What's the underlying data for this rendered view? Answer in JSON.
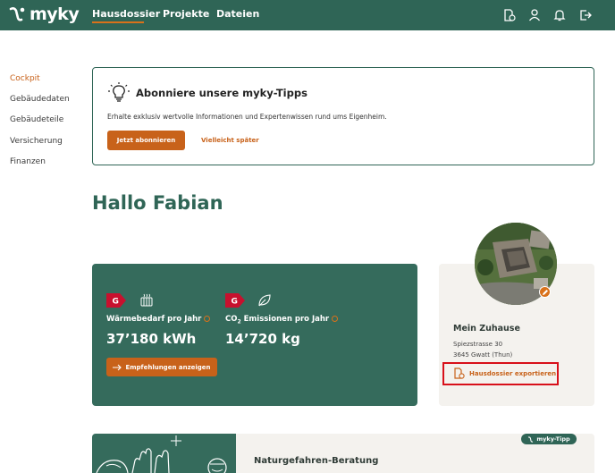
{
  "brand": {
    "name": "myky"
  },
  "nav": {
    "items": [
      {
        "label": "Hausdossier",
        "active": true
      },
      {
        "label": "Projekte"
      },
      {
        "label": "Dateien"
      }
    ],
    "icons": [
      "house-document-icon",
      "user-icon",
      "bell-icon",
      "logout-icon"
    ]
  },
  "sidebar": {
    "items": [
      {
        "label": "Cockpit",
        "active": true
      },
      {
        "label": "Gebäudedaten"
      },
      {
        "label": "Gebäudeteile"
      },
      {
        "label": "Versicherung"
      },
      {
        "label": "Finanzen"
      }
    ]
  },
  "tips": {
    "title": "Abonniere unsere myky-Tipps",
    "text": "Erhalte exklusiv wertvolle Informationen und Expertenwissen rund ums Eigenheim.",
    "subscribe_label": "Jetzt abonnieren",
    "later_label": "Vielleicht später"
  },
  "greeting": "Hallo Fabian",
  "energy": {
    "heat": {
      "grade": "G",
      "label": "Wärmebedarf pro Jahr",
      "value": "37’180 kWh"
    },
    "co2": {
      "grade": "G",
      "label_prefix": "CO",
      "label_sub": "2",
      "label_suffix": " Emissionen pro Jahr",
      "value": "14’720 kg"
    },
    "recommend_label": "Empfehlungen anzeigen"
  },
  "home": {
    "title": "Mein Zuhause",
    "street": "Spiezstrasse 30",
    "city": "3645 Gwatt (Thun)",
    "export_label": "Hausdossier exportieren"
  },
  "teaser": {
    "title": "Naturgefahren-Beratung",
    "pill": "myky-Tipp"
  },
  "colors": {
    "primary": "#2f6556",
    "accent": "#c8621a",
    "grade_red": "#c8102e",
    "highlight": "#d8101a"
  }
}
